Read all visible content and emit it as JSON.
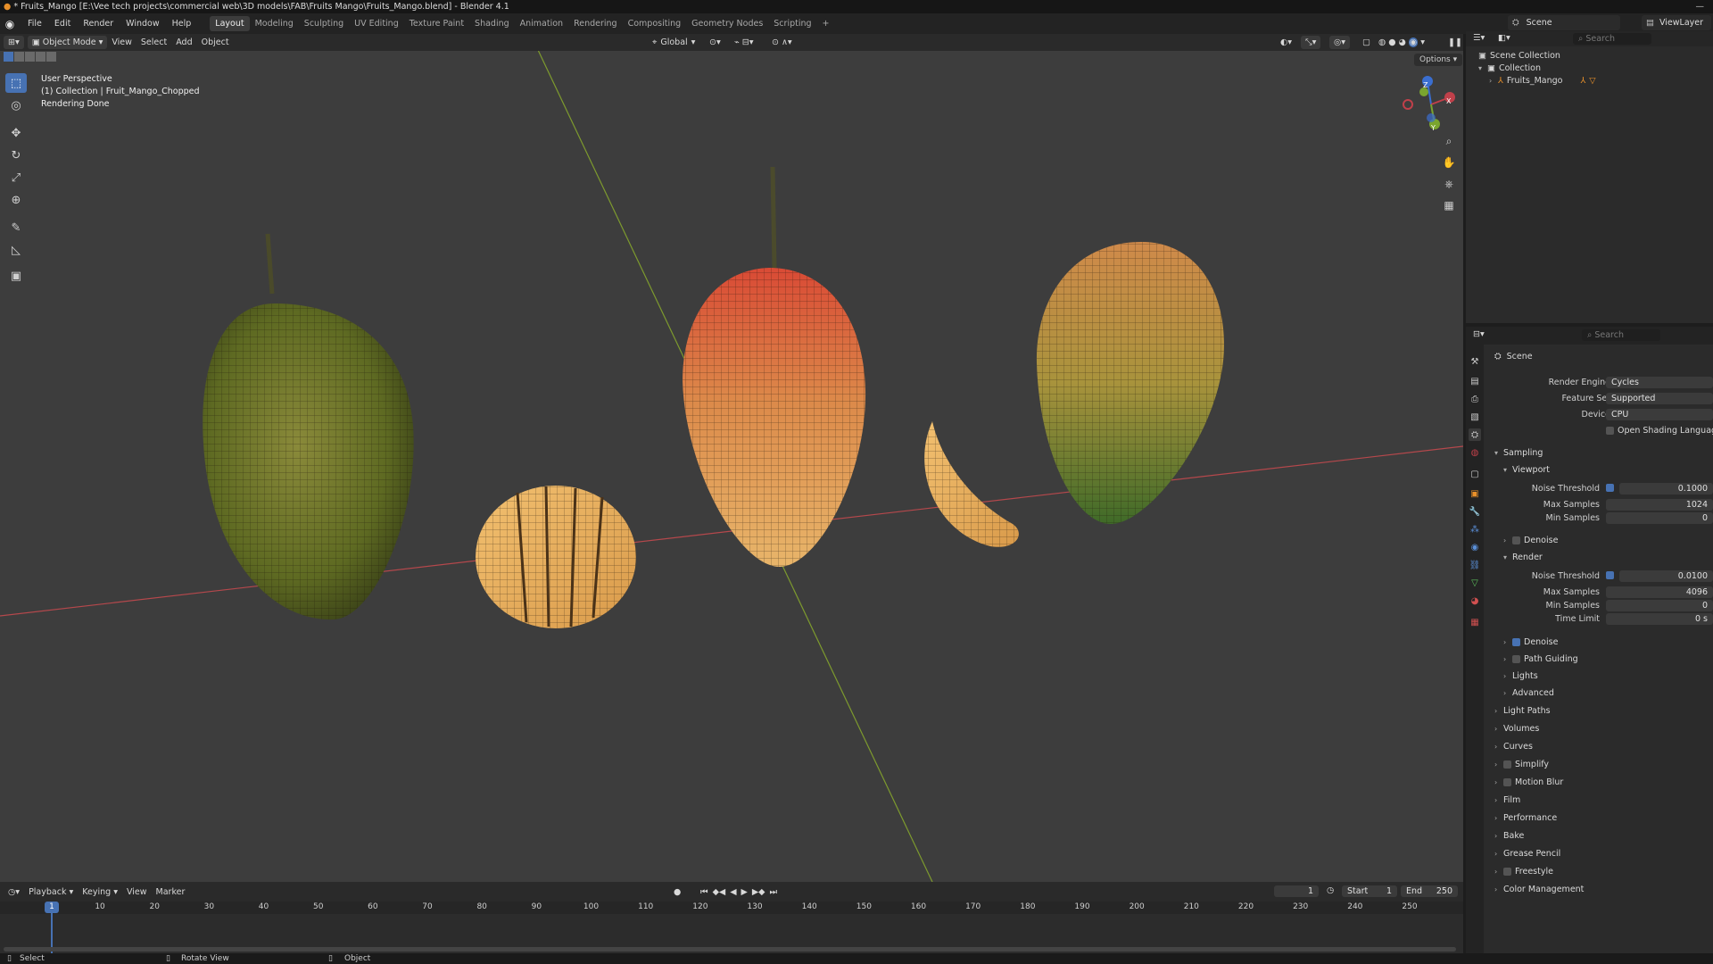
{
  "title_bar": {
    "text": "* Fruits_Mango [E:\\Vee tech projects\\commercial web\\3D models\\FAB\\Fruits Mango\\Fruits_Mango.blend] - Blender 4.1",
    "window_control": "—"
  },
  "menu": {
    "items": [
      "File",
      "Edit",
      "Render",
      "Window",
      "Help"
    ],
    "add_workspace": "+"
  },
  "workspaces": [
    "Layout",
    "Modeling",
    "Sculpting",
    "UV Editing",
    "Texture Paint",
    "Shading",
    "Animation",
    "Rendering",
    "Compositing",
    "Geometry Nodes",
    "Scripting"
  ],
  "active_workspace": "Layout",
  "scene_selector": {
    "label": "Scene"
  },
  "view_layer_selector": {
    "label": "ViewLayer"
  },
  "viewport_header": {
    "mode": "Object Mode",
    "menus": [
      "View",
      "Select",
      "Add",
      "Object"
    ],
    "transform_orientation": "Global",
    "options": "Options"
  },
  "viewport_overlay": {
    "line1": "User Perspective",
    "line2": "(1) Collection | Fruit_Mango_Chopped",
    "line3": "Rendering Done"
  },
  "gizmo": {
    "z": "Z",
    "y": "Y",
    "x": "X"
  },
  "timeline": {
    "menus": [
      "Playback",
      "Keying",
      "View",
      "Marker"
    ],
    "current_frame": "1",
    "start_label": "Start",
    "start": "1",
    "end_label": "End",
    "end": "250",
    "ruler": [
      "1",
      "10",
      "20",
      "30",
      "40",
      "50",
      "60",
      "70",
      "80",
      "90",
      "100",
      "110",
      "120",
      "130",
      "140",
      "150",
      "160",
      "170",
      "180",
      "190",
      "200",
      "210",
      "220",
      "230",
      "240",
      "250"
    ]
  },
  "status_bar": {
    "select": "Select",
    "rotate": "Rotate View",
    "object": "Object"
  },
  "outliner": {
    "search_placeholder": "Search",
    "scene_collection": "Scene Collection",
    "collection": "Collection",
    "object": "Fruits_Mango"
  },
  "properties": {
    "search_placeholder": "Search",
    "context": "Scene",
    "render_engine_label": "Render Engine",
    "render_engine": "Cycles",
    "feature_set_label": "Feature Set",
    "feature_set": "Supported",
    "device_label": "Device",
    "device": "CPU",
    "osl_label": "Open Shading Language",
    "sampling": "Sampling",
    "viewport": "Viewport",
    "vp_noise_label": "Noise Threshold",
    "vp_noise": "0.1000",
    "vp_max_label": "Max Samples",
    "vp_max": "1024",
    "vp_min_label": "Min Samples",
    "vp_min": "0",
    "vp_denoise": "Denoise",
    "render": "Render",
    "r_noise_label": "Noise Threshold",
    "r_noise": "0.0100",
    "r_max_label": "Max Samples",
    "r_max": "4096",
    "r_min_label": "Min Samples",
    "r_min": "0",
    "r_time_label": "Time Limit",
    "r_time": "0 s",
    "r_denoise": "Denoise",
    "path_guiding": "Path Guiding",
    "lights": "Lights",
    "advanced": "Advanced",
    "panels": [
      "Light Paths",
      "Volumes",
      "Curves",
      "Simplify",
      "Motion Blur",
      "Film",
      "Performance",
      "Bake",
      "Grease Pencil",
      "Freestyle",
      "Color Management"
    ]
  },
  "colors": {
    "accent": "#4772b3",
    "viewport_bg": "#3d3d3d",
    "x_axis": "#b5484c",
    "y_axis": "#7d9a2e"
  }
}
